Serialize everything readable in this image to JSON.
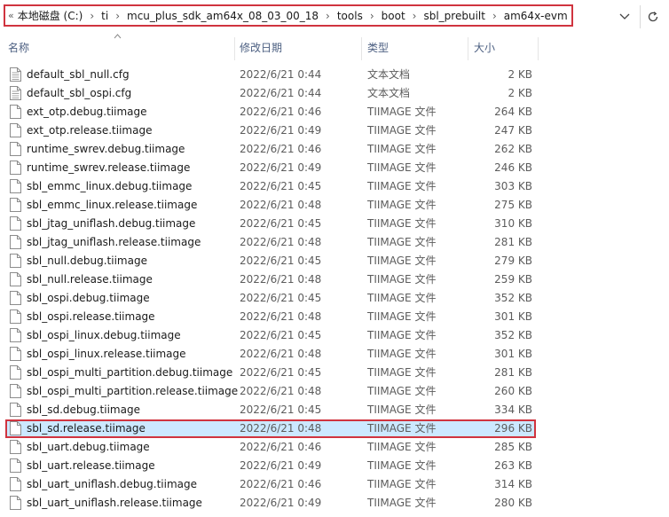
{
  "breadcrumb": {
    "overflow_glyph": "«",
    "parts": [
      "本地磁盘 (C:)",
      "ti",
      "mcu_plus_sdk_am64x_08_03_00_18",
      "tools",
      "boot",
      "sbl_prebuilt",
      "am64x-evm"
    ],
    "separator": "›"
  },
  "header": {
    "name": "名称",
    "date": "修改日期",
    "type": "类型",
    "size": "大小"
  },
  "colors": {
    "highlight_border": "#d0343f",
    "selection_bg": "#cce8ff",
    "header_text": "#4d6082"
  },
  "files": [
    {
      "name": "default_sbl_null.cfg",
      "date": "2022/6/21 0:44",
      "type": "文本文档",
      "size": "2 KB",
      "icon": "text-file-icon"
    },
    {
      "name": "default_sbl_ospi.cfg",
      "date": "2022/6/21 0:44",
      "type": "文本文档",
      "size": "2 KB",
      "icon": "text-file-icon"
    },
    {
      "name": "ext_otp.debug.tiimage",
      "date": "2022/6/21 0:46",
      "type": "TIIMAGE 文件",
      "size": "264 KB",
      "icon": "file-icon"
    },
    {
      "name": "ext_otp.release.tiimage",
      "date": "2022/6/21 0:49",
      "type": "TIIMAGE 文件",
      "size": "247 KB",
      "icon": "file-icon"
    },
    {
      "name": "runtime_swrev.debug.tiimage",
      "date": "2022/6/21 0:46",
      "type": "TIIMAGE 文件",
      "size": "262 KB",
      "icon": "file-icon"
    },
    {
      "name": "runtime_swrev.release.tiimage",
      "date": "2022/6/21 0:49",
      "type": "TIIMAGE 文件",
      "size": "246 KB",
      "icon": "file-icon"
    },
    {
      "name": "sbl_emmc_linux.debug.tiimage",
      "date": "2022/6/21 0:45",
      "type": "TIIMAGE 文件",
      "size": "303 KB",
      "icon": "file-icon"
    },
    {
      "name": "sbl_emmc_linux.release.tiimage",
      "date": "2022/6/21 0:48",
      "type": "TIIMAGE 文件",
      "size": "275 KB",
      "icon": "file-icon"
    },
    {
      "name": "sbl_jtag_uniflash.debug.tiimage",
      "date": "2022/6/21 0:45",
      "type": "TIIMAGE 文件",
      "size": "310 KB",
      "icon": "file-icon"
    },
    {
      "name": "sbl_jtag_uniflash.release.tiimage",
      "date": "2022/6/21 0:48",
      "type": "TIIMAGE 文件",
      "size": "281 KB",
      "icon": "file-icon"
    },
    {
      "name": "sbl_null.debug.tiimage",
      "date": "2022/6/21 0:45",
      "type": "TIIMAGE 文件",
      "size": "279 KB",
      "icon": "file-icon"
    },
    {
      "name": "sbl_null.release.tiimage",
      "date": "2022/6/21 0:48",
      "type": "TIIMAGE 文件",
      "size": "259 KB",
      "icon": "file-icon"
    },
    {
      "name": "sbl_ospi.debug.tiimage",
      "date": "2022/6/21 0:45",
      "type": "TIIMAGE 文件",
      "size": "352 KB",
      "icon": "file-icon"
    },
    {
      "name": "sbl_ospi.release.tiimage",
      "date": "2022/6/21 0:48",
      "type": "TIIMAGE 文件",
      "size": "301 KB",
      "icon": "file-icon"
    },
    {
      "name": "sbl_ospi_linux.debug.tiimage",
      "date": "2022/6/21 0:45",
      "type": "TIIMAGE 文件",
      "size": "352 KB",
      "icon": "file-icon"
    },
    {
      "name": "sbl_ospi_linux.release.tiimage",
      "date": "2022/6/21 0:48",
      "type": "TIIMAGE 文件",
      "size": "301 KB",
      "icon": "file-icon"
    },
    {
      "name": "sbl_ospi_multi_partition.debug.tiimage",
      "date": "2022/6/21 0:45",
      "type": "TIIMAGE 文件",
      "size": "281 KB",
      "icon": "file-icon"
    },
    {
      "name": "sbl_ospi_multi_partition.release.tiimage",
      "date": "2022/6/21 0:48",
      "type": "TIIMAGE 文件",
      "size": "260 KB",
      "icon": "file-icon"
    },
    {
      "name": "sbl_sd.debug.tiimage",
      "date": "2022/6/21 0:45",
      "type": "TIIMAGE 文件",
      "size": "334 KB",
      "icon": "file-icon"
    },
    {
      "name": "sbl_sd.release.tiimage",
      "date": "2022/6/21 0:48",
      "type": "TIIMAGE 文件",
      "size": "296 KB",
      "icon": "file-icon",
      "selected": true
    },
    {
      "name": "sbl_uart.debug.tiimage",
      "date": "2022/6/21 0:46",
      "type": "TIIMAGE 文件",
      "size": "285 KB",
      "icon": "file-icon"
    },
    {
      "name": "sbl_uart.release.tiimage",
      "date": "2022/6/21 0:49",
      "type": "TIIMAGE 文件",
      "size": "263 KB",
      "icon": "file-icon"
    },
    {
      "name": "sbl_uart_uniflash.debug.tiimage",
      "date": "2022/6/21 0:46",
      "type": "TIIMAGE 文件",
      "size": "314 KB",
      "icon": "file-icon"
    },
    {
      "name": "sbl_uart_uniflash.release.tiimage",
      "date": "2022/6/21 0:49",
      "type": "TIIMAGE 文件",
      "size": "280 KB",
      "icon": "file-icon"
    }
  ]
}
